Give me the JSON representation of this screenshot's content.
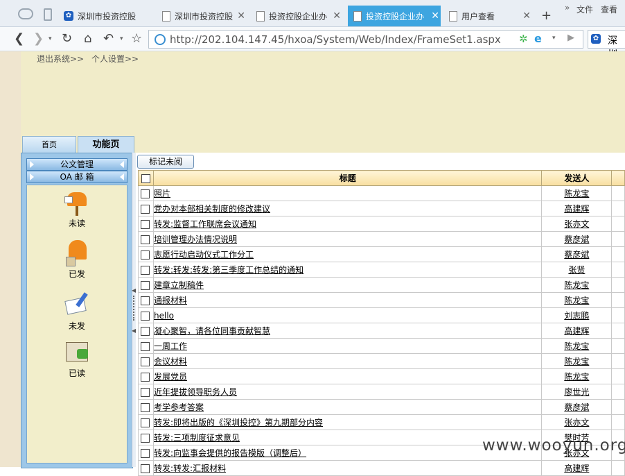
{
  "browser": {
    "tabs": [
      {
        "label": "深圳市投资控股",
        "icon": "paw-icon",
        "active": false
      },
      {
        "label": "深圳市投资控股",
        "icon": "doc-icon",
        "active": false
      },
      {
        "label": "投资控股企业办",
        "icon": "doc-icon",
        "active": false
      },
      {
        "label": "投资控股企业办",
        "icon": "doc-icon",
        "active": true
      },
      {
        "label": "用户查看",
        "icon": "doc-icon",
        "active": false
      }
    ],
    "menu_file": "文件",
    "menu_view": "查看",
    "url": "http://202.104.147.45/hxoa/System/Web/Index/FrameSet1.aspx",
    "search_label": "深圳"
  },
  "header": {
    "logout": "退出系统>>",
    "settings": "个人设置>>"
  },
  "nav": {
    "home": "首页",
    "functions": "功能页"
  },
  "sidebar": {
    "section_docs": "公文管理",
    "section_mail": "OA 邮 箱",
    "items": [
      {
        "label": "未读",
        "icon": "mailbox-icon"
      },
      {
        "label": "已发",
        "icon": "sent-mailbox-icon"
      },
      {
        "label": "未发",
        "icon": "envelope-brush-icon"
      },
      {
        "label": "已读",
        "icon": "open-envelope-icon"
      }
    ]
  },
  "main": {
    "mark_unread": "标记未阅",
    "columns": {
      "title": "标题",
      "sender": "发送人"
    },
    "rows": [
      {
        "title": "照片",
        "sender": "陈龙宝"
      },
      {
        "title": "党办对本部相关制度的修改建议",
        "sender": "高建辉"
      },
      {
        "title": "转发:监督工作联席会议通知",
        "sender": "张亦文"
      },
      {
        "title": "培训管理办法情况说明",
        "sender": "蔡彦斌"
      },
      {
        "title": "志愿行动启动仪式工作分工",
        "sender": "蔡彦斌"
      },
      {
        "title": "转发:转发:转发:第三季度工作总结的通知",
        "sender": "张贤"
      },
      {
        "title": "建章立制稿件",
        "sender": "陈龙宝"
      },
      {
        "title": "通报材料",
        "sender": "陈龙宝"
      },
      {
        "title": "hello",
        "sender": "刘志鹏"
      },
      {
        "title": "凝心聚智，请各位同事贡献智慧",
        "sender": "高建辉"
      },
      {
        "title": "一周工作",
        "sender": "陈龙宝"
      },
      {
        "title": "会议材料",
        "sender": "陈龙宝"
      },
      {
        "title": "发展党员",
        "sender": "陈龙宝"
      },
      {
        "title": "近年提拔领导职务人员",
        "sender": "廖世光"
      },
      {
        "title": "考学参考答案",
        "sender": "蔡彦斌"
      },
      {
        "title": "转发:即将出版的《深圳投控》第九期部分内容",
        "sender": "张亦文"
      },
      {
        "title": "转发:三项制度征求意见",
        "sender": "樊时芳"
      },
      {
        "title": "转发:向监事会提供的报告模版（调整后）",
        "sender": "张亦文"
      },
      {
        "title": "转发:转发:汇报材料",
        "sender": "高建辉"
      }
    ]
  },
  "watermark": "www.wooyun.org"
}
